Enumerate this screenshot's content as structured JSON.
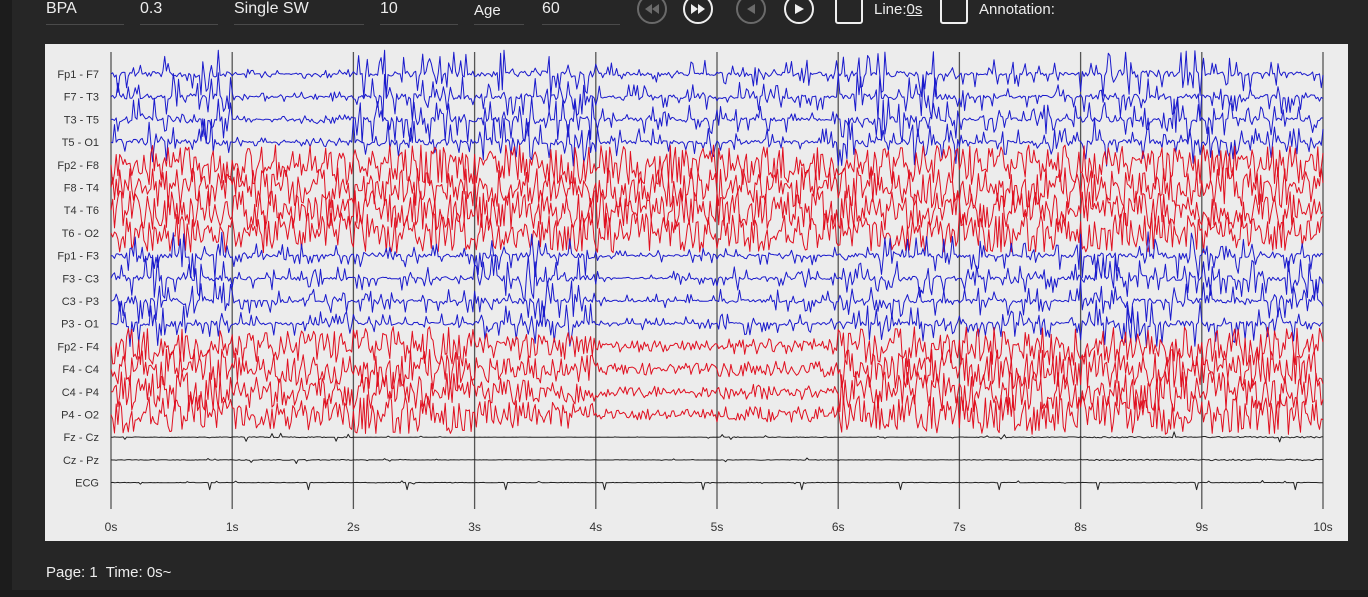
{
  "toolbar": {
    "montage_label": "BPA",
    "lowcut_value": "0.3",
    "mode_value": "Single SW",
    "timebase_value": "10",
    "age_label": "Age",
    "age_value": "60",
    "line_label": "Line:",
    "line_value": "0s",
    "annotation_label": "Annotation:"
  },
  "chart_data": {
    "type": "line",
    "title": "",
    "xlabel": "",
    "ylabel": "",
    "xlim": [
      0,
      10
    ],
    "x_ticks": [
      "0s",
      "1s",
      "2s",
      "3s",
      "4s",
      "5s",
      "6s",
      "7s",
      "8s",
      "9s",
      "10s"
    ],
    "grid": "vertical lines at each second",
    "channels": [
      {
        "name": "Fp1 - F7",
        "color": "#1a1acc"
      },
      {
        "name": "F7 - T3",
        "color": "#1a1acc"
      },
      {
        "name": "T3 - T5",
        "color": "#1a1acc"
      },
      {
        "name": "T5 - O1",
        "color": "#1a1acc"
      },
      {
        "name": "Fp2 - F8",
        "color": "#e01020"
      },
      {
        "name": "F8 - T4",
        "color": "#e01020"
      },
      {
        "name": "T4 - T6",
        "color": "#e01020"
      },
      {
        "name": "T6 - O2",
        "color": "#e01020"
      },
      {
        "name": "Fp1 - F3",
        "color": "#1a1acc"
      },
      {
        "name": "F3 - C3",
        "color": "#1a1acc"
      },
      {
        "name": "C3 - P3",
        "color": "#1a1acc"
      },
      {
        "name": "P3 - O1",
        "color": "#1a1acc"
      },
      {
        "name": "Fp2 - F4",
        "color": "#e01020"
      },
      {
        "name": "F4 - C4",
        "color": "#e01020"
      },
      {
        "name": "C4 - P4",
        "color": "#e01020"
      },
      {
        "name": "P4 - O2",
        "color": "#e01020"
      },
      {
        "name": "Fz - Cz",
        "color": "#222222"
      },
      {
        "name": "Cz - Pz",
        "color": "#222222"
      },
      {
        "name": "ECG",
        "color": "#222222"
      }
    ]
  },
  "status": {
    "page": "Page: 1",
    "time": "Time: 0s~"
  },
  "icons": [
    "rewind-icon",
    "fast-forward-icon",
    "step-back-icon",
    "play-icon"
  ]
}
